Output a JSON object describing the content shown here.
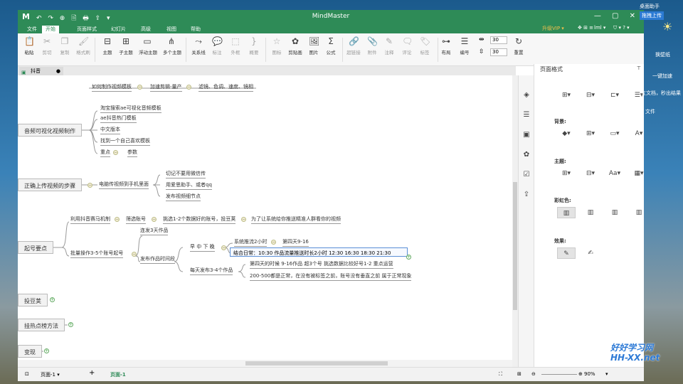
{
  "app": {
    "logo": "M",
    "title": "MindMaster",
    "quick_access": "↶ ↷ ⊕ 🗎 🖶 ⇪ ▾",
    "window_controls": "— ▢ ✕"
  },
  "menu": {
    "items": [
      "文件",
      "开始",
      "页面样式",
      "幻灯片",
      "高级",
      "视图",
      "帮助"
    ],
    "active": "开始",
    "vip": "升级VIP ▾",
    "right_icons": "✥ ⊞ ≡ ",
    "user": "lml ▾",
    "extra": "⛉ ▾ ? ▾"
  },
  "ribbon": {
    "paste": "粘贴",
    "cut": "剪切",
    "copy": "复制",
    "format_painter": "格式刷",
    "topic": "主题",
    "subtopic": "子主题",
    "floating_topic": "浮动主题",
    "multi_topic": "多个主题",
    "relation": "关系线",
    "label": "标注",
    "outline": "外框",
    "summary": "概要",
    "icon": "图标",
    "clipart": "剪贴画",
    "image": "图片",
    "formula": "公式",
    "hyperlink": "超链接",
    "attachment": "附件",
    "note": "注释",
    "comment": "评论",
    "tag": "标签",
    "layout": "布局",
    "numbering": "编号",
    "spacing_h": "30",
    "spacing_v": "30",
    "reset": "重置"
  },
  "doc_tab": {
    "name": "抖音",
    "dot": "●"
  },
  "mindmap": {
    "top_items": [
      "如何制作视频模板",
      "加速剪辑-量产",
      "滤镜、色调、速度、镜相"
    ],
    "branches": {
      "audio": {
        "title": "音频可视化视频制作",
        "children": [
          "淘宝搜索ae可视化音频模板",
          "ae抖音热门模板",
          "中文版本",
          "找到一个自己喜欢模板",
          "重点",
          "参数"
        ]
      },
      "upload": {
        "title": "正确上传视频的步骤",
        "child": "电脑传视频到手机里面",
        "grandchildren": [
          "切记不要用微信传",
          "用爱思助手、或者qq",
          "发布视频细节点"
        ]
      },
      "account": {
        "title": "起号要点",
        "row1": [
          "利用抖音赛马机制",
          "筛选账号",
          "挑选1-2个数据好的账号，投豆荚",
          "为了让系统给你推送精准人群看你的视频"
        ],
        "batch": "批量操作3-5个账号起号",
        "cont": "连发3天作品",
        "publish": "发布作品时间段",
        "times": "早 中 下 晚",
        "push": "系统推流2小时",
        "day4": "第四天9-16",
        "combine": "结合日常：10:30    作品流量推送时长2小时    12:30 16:30    18:30    21:30",
        "daily": "每天发布3-4个作品",
        "day4b": "第四天的时候 9-16作品   超3个号 挑选数据比较好号1-2 重点运营",
        "normal": "200-500都是正常，在没有被标签之前，账号没有垂直之前 属于正常现象"
      },
      "doujia": "投豆荚",
      "hotlist": "挂热点榜方法",
      "monetize": "变现"
    }
  },
  "panel": {
    "title": "页面格式",
    "pin": "⊤",
    "background": "背景:",
    "theme": "主题:",
    "rainbow": "彩虹色:",
    "effect": "效果:"
  },
  "status": {
    "page_selector": "页面-1 ▾",
    "add": "+",
    "page_tab": "页面-1",
    "zoom": "90%",
    "fit": "⛶",
    "zoom_out": "⊖",
    "zoom_in": "⊕"
  },
  "desktop": {
    "assistant": "桌面助手",
    "upload": "拖拽上传",
    "skin": "换壁纸",
    "cleanup": "一键加速",
    "tip": "立文档，秒出结果",
    "file": "文件"
  },
  "watermark": {
    "line1": "好好学习网",
    "line2": "HH-XX.net"
  }
}
